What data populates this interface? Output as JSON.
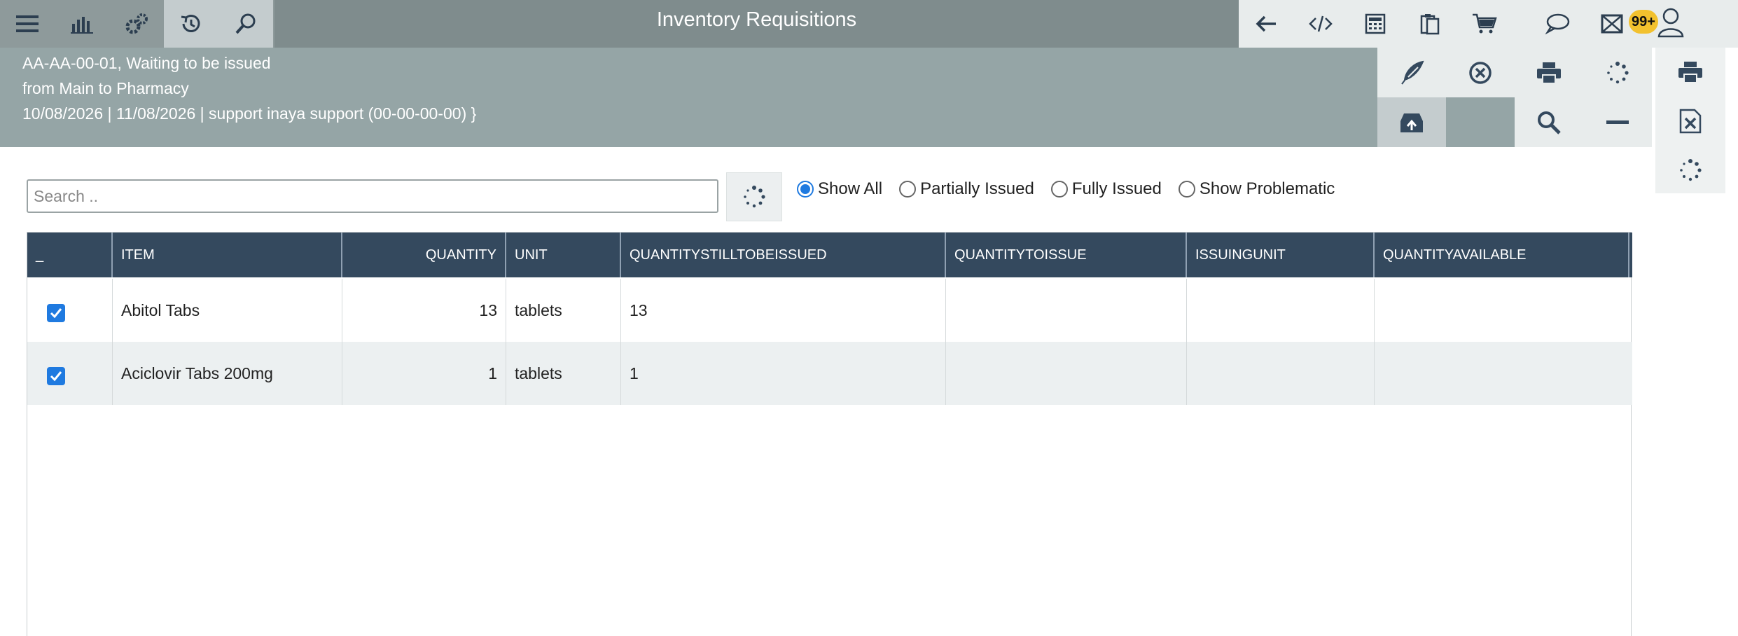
{
  "app": {
    "title": "Inventory Requisitions"
  },
  "toolbar_left": [
    {
      "name": "menu-icon"
    },
    {
      "name": "bar-chart-icon"
    },
    {
      "name": "settings-gears-icon"
    },
    {
      "name": "history-icon",
      "active": true
    },
    {
      "name": "search-icon"
    }
  ],
  "toolbar_right": [
    {
      "name": "back-arrow-icon"
    },
    {
      "name": "code-icon"
    },
    {
      "name": "calculator-icon"
    },
    {
      "name": "clipboard-icon"
    },
    {
      "name": "cart-icon"
    },
    {
      "name": "chat-icon"
    },
    {
      "name": "mail-icon"
    }
  ],
  "notifications": {
    "badge": "99+"
  },
  "header": {
    "line1": "AA-AA-00-01, Waiting to be issued",
    "line2": "from Main to Pharmacy",
    "line3": "10/08/2026 | 11/08/2026 | support inaya support (00-00-00-00) }"
  },
  "actions": [
    "feather-sign-icon",
    "cancel-circle-icon",
    "print-icon",
    "loading-spinner-icon",
    "archive-icon",
    "blank",
    "zoom-icon",
    "minus-icon"
  ],
  "side_actions": [
    "print-icon",
    "excel-export-icon",
    "loading-spinner-icon"
  ],
  "search": {
    "placeholder": "Search ..",
    "value": ""
  },
  "filters": [
    {
      "label": "Show All",
      "selected": true
    },
    {
      "label": "Partially Issued",
      "selected": false
    },
    {
      "label": "Fully Issued",
      "selected": false
    },
    {
      "label": "Show Problematic",
      "selected": false
    }
  ],
  "table": {
    "columns": [
      "_",
      "ITEM",
      "QUANTITY",
      "UNIT",
      "QUANTITYSTILLTOBEISSUED",
      "QUANTITYTOISSUE",
      "ISSUINGUNIT",
      "QUANTITYAVAILABLE"
    ],
    "rows": [
      {
        "checked": true,
        "item": "Abitol Tabs",
        "quantity": "13",
        "unit": "tablets",
        "still": "13",
        "toissue": "",
        "issuingunit": "",
        "available": ""
      },
      {
        "checked": true,
        "item": "Aciclovir Tabs 200mg",
        "quantity": "1",
        "unit": "tablets",
        "still": "1",
        "toissue": "",
        "issuingunit": "",
        "available": ""
      }
    ]
  },
  "colors": {
    "topbar": "#7f8c8d",
    "header": "#95a5a6",
    "table_header": "#34495e",
    "accent": "#1f7ae0",
    "badge": "#f2c12e"
  }
}
